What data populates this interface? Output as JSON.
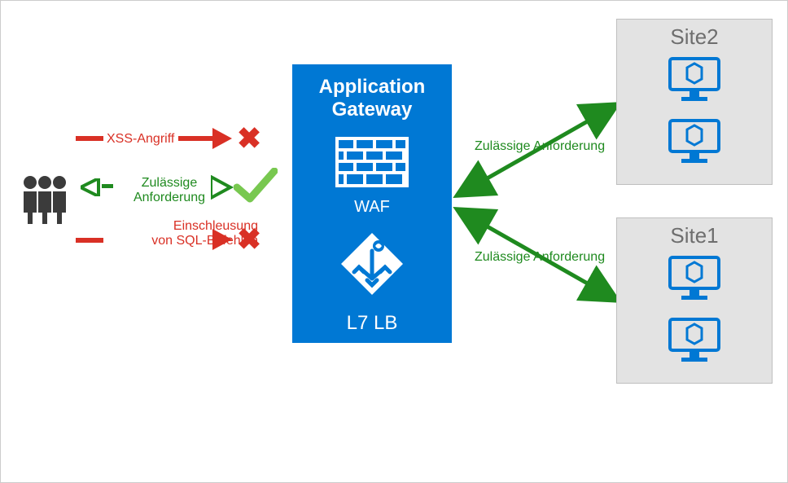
{
  "gateway": {
    "title_line1": "Application",
    "title_line2": "Gateway",
    "waf_label": "WAF",
    "l7_label": "L7 LB"
  },
  "sites": {
    "site1_title": "Site1",
    "site2_title": "Site2"
  },
  "labels": {
    "xss": "XSS-Angriff",
    "valid_response_line1": "Zulässige",
    "valid_response_line2": "Anforderung",
    "sql_line1": "Einschleusung",
    "sql_line2": "von SQL-Befehlen",
    "valid_request_top": "Zulässige Anforderung",
    "valid_request_bottom": "Zulässige Anforderung"
  }
}
